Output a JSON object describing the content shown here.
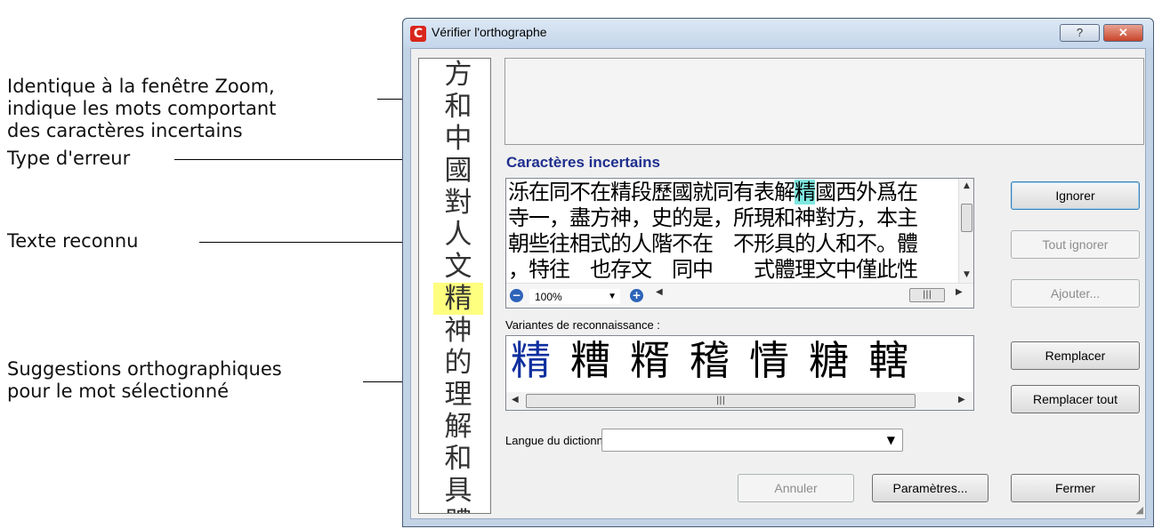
{
  "annotations": {
    "zoom_note": [
      "Identique à la fenêtre Zoom,",
      "indique les mots comportant",
      "des caractères incertains"
    ],
    "error_type": "Type d'erreur",
    "recognized_text": "Texte reconnu",
    "suggestions": [
      "Suggestions orthographiques",
      "pour le mot sélectionné"
    ]
  },
  "dialog": {
    "title": "Vérifier l'orthographe",
    "help_label": "?",
    "close_label": "✕"
  },
  "zoom_chars": [
    "方",
    "和",
    "中",
    "國",
    "對",
    "人",
    "文",
    "精",
    "神",
    "的",
    "理",
    "解",
    "和",
    "具",
    "體"
  ],
  "zoom_highlight_index": 7,
  "error_type_label": "Caractères incertains",
  "text_lines": [
    {
      "before": "泺在同不在精段歷國就同有表解",
      "hl": "精",
      "after": "國西外爲在"
    },
    {
      "before": "寺一，盡方神，史的是，所現和神對方，本主",
      "hl": "",
      "after": ""
    },
    {
      "before": "朝些往相式的人階不在　不形具的人和不。體",
      "hl": "",
      "after": ""
    },
    {
      "before": "，特往　也存文　同中　　式體理文中僅此性",
      "hl": "",
      "after": ""
    }
  ],
  "zoom_level": "100%",
  "variants_label": "Variantes de reconnaissance :",
  "variants": [
    "精",
    "糟",
    "糈",
    "稽",
    "情",
    "糖",
    "轄"
  ],
  "dictionary_label": "Langue du dictionnaire :",
  "dictionary_value": "",
  "buttons": {
    "ignore": "Ignorer",
    "ignore_all": "Tout ignorer",
    "add": "Ajouter...",
    "replace": "Remplacer",
    "replace_all": "Remplacer tout",
    "cancel": "Annuler",
    "settings": "Paramètres...",
    "close": "Fermer"
  }
}
